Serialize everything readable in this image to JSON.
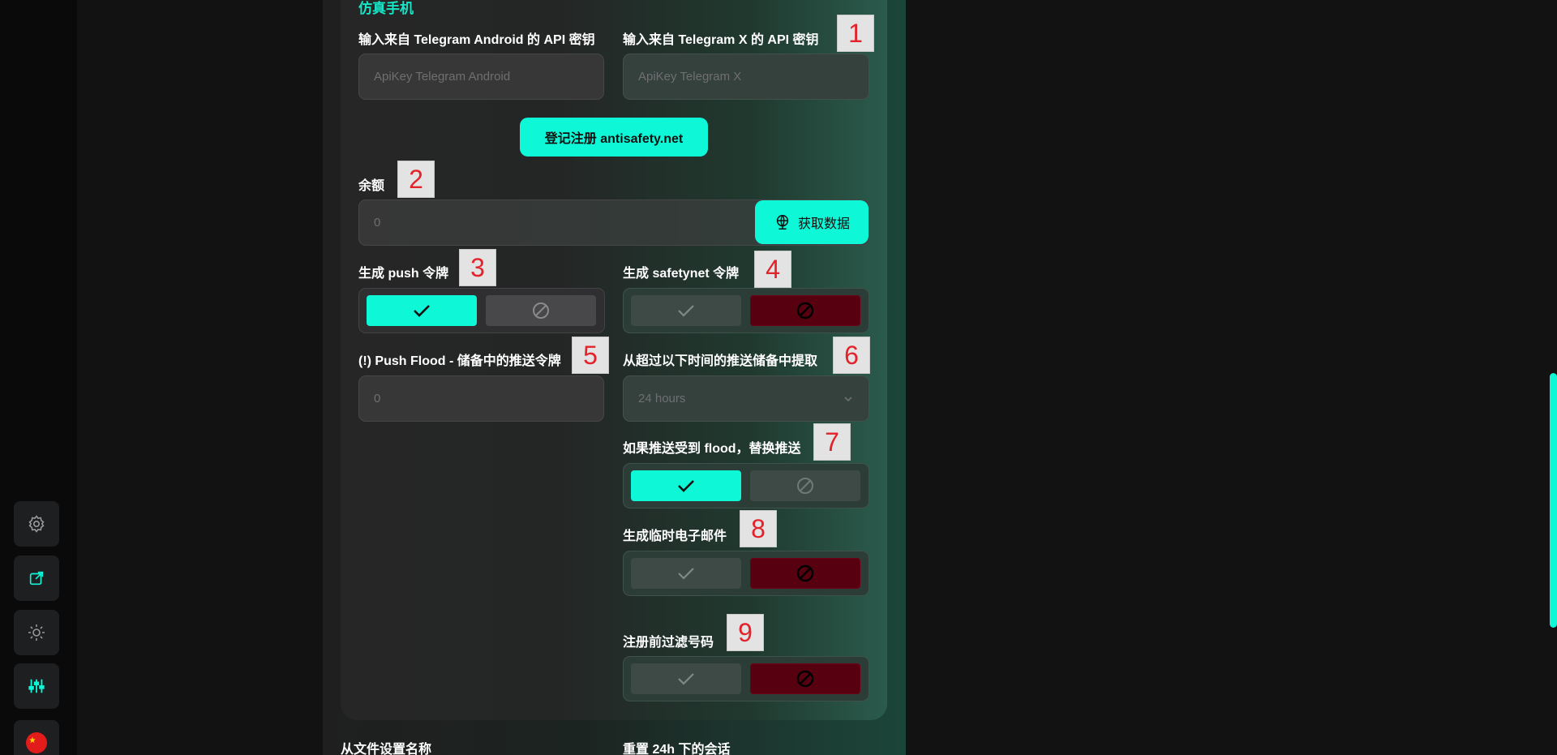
{
  "section_title": "仿真手机",
  "api": {
    "android_label": "输入来自 Telegram Android 的 API 密钥",
    "android_placeholder": "ApiKey Telegram Android",
    "x_label": "输入来自 Telegram X 的 API 密钥",
    "x_placeholder": "ApiKey Telegram X"
  },
  "register_button": "登记注册 antisafety.net",
  "balance": {
    "label": "余额",
    "value": "0",
    "fetch_button": "获取数据"
  },
  "push_token": {
    "label": "生成 push 令牌",
    "state": "enabled"
  },
  "safetynet_token": {
    "label": "生成 safetynet 令牌",
    "state": "disabled"
  },
  "push_flood": {
    "label": "(!) Push Flood - 储备中的推送令牌",
    "value": "0"
  },
  "extract_from": {
    "label": "从超过以下时间的推送储备中提取",
    "selected": "24 hours"
  },
  "replace_push": {
    "label": "如果推送受到 flood，替换推送",
    "state": "enabled"
  },
  "temp_email": {
    "label": "生成临时电子邮件",
    "state": "disabled"
  },
  "filter_numbers": {
    "label": "注册前过滤号码",
    "state": "disabled"
  },
  "bottom": {
    "names_from_file": "从文件设置名称",
    "reset_sessions": "重置 24h 下的会话"
  },
  "markers": [
    "1",
    "2",
    "3",
    "4",
    "5",
    "6",
    "7",
    "8",
    "9"
  ],
  "colors": {
    "accent": "#0ef7d6",
    "danger": "#570010",
    "marker_text": "#e2232b"
  },
  "icons": {
    "nav": [
      "gear-icon",
      "external-link-icon",
      "sun-icon",
      "sliders-icon",
      "china-flag-icon"
    ],
    "check": "check-icon",
    "ban": "ban-icon",
    "globe": "globe-icon",
    "chevron": "chevron-down-icon"
  }
}
